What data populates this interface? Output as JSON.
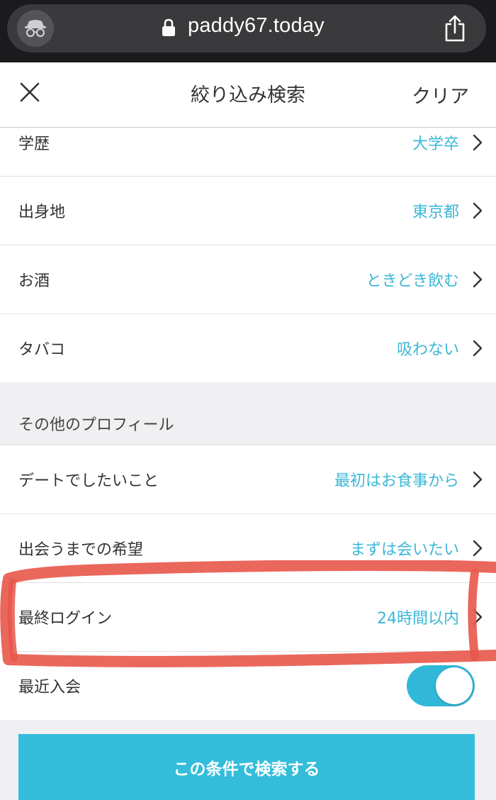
{
  "browser": {
    "url": "paddy67.today",
    "icons": [
      "incognito-icon",
      "lock-icon",
      "share-icon"
    ]
  },
  "header": {
    "title": "絞り込み検索",
    "clear_label": "クリア",
    "close_icon": "close-icon"
  },
  "rows_top": [
    {
      "label": "学歴",
      "value": "大学卒"
    },
    {
      "label": "出身地",
      "value": "東京都"
    },
    {
      "label": "お酒",
      "value": "ときどき飲む"
    },
    {
      "label": "タバコ",
      "value": "吸わない"
    }
  ],
  "other_profile": {
    "title": "その他のプロフィール",
    "rows": [
      {
        "label": "デートでしたいこと",
        "value": "最初はお食事から"
      },
      {
        "label": "出会うまでの希望",
        "value": "まずは会いたい"
      },
      {
        "label": "最終ログイン",
        "value": "24時間以内"
      }
    ]
  },
  "recent_join": {
    "label": "最近入会",
    "enabled": true
  },
  "search_button": {
    "label": "この条件で検索する"
  },
  "colors": {
    "accent": "#3cb7d6",
    "button": "#33bddb",
    "highlight": "#e8564a"
  }
}
